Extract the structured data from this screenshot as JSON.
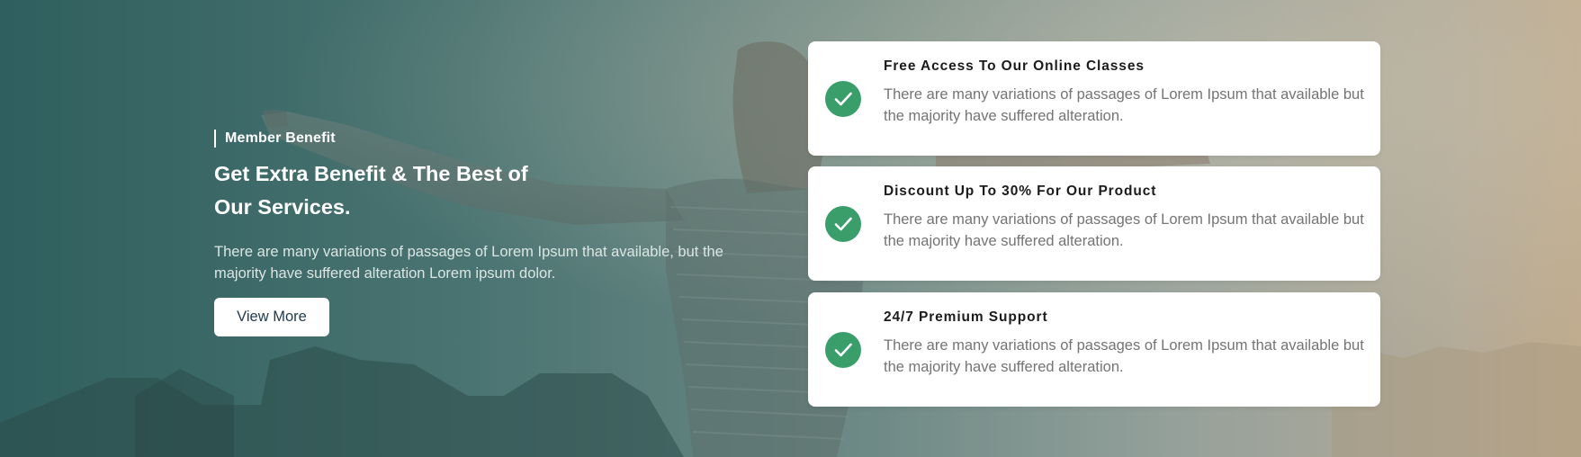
{
  "hero": {
    "eyebrow": "Member Benefit",
    "heading_line1": "Get Extra Benefit & The Best of",
    "heading_line2": "Our Services.",
    "description": "There are many variations of passages of Lorem Ipsum that available, but the majority have suffered alteration Lorem ipsum dolor.",
    "button_label": "View More"
  },
  "benefits": [
    {
      "title": "Free Access To Our Online Classes",
      "description": "There are many variations of passages of Lorem Ipsum that available but the majority have suffered alteration.",
      "icon": "check-circle-icon"
    },
    {
      "title": "Discount Up To 30% For Our Product",
      "description": "There are many variations of passages of Lorem Ipsum that available but the majority have suffered alteration.",
      "icon": "check-circle-icon"
    },
    {
      "title": "24/7 Premium Support",
      "description": "There are many variations of passages of Lorem Ipsum that available but the majority have suffered alteration.",
      "icon": "check-circle-icon"
    }
  ],
  "colors": {
    "accent": "#3a9e6a",
    "overlay_dark": "#2f5f5e",
    "overlay_warm": "#c0ab8d",
    "card_bg": "#ffffff",
    "button_text": "#1f3b4d"
  }
}
